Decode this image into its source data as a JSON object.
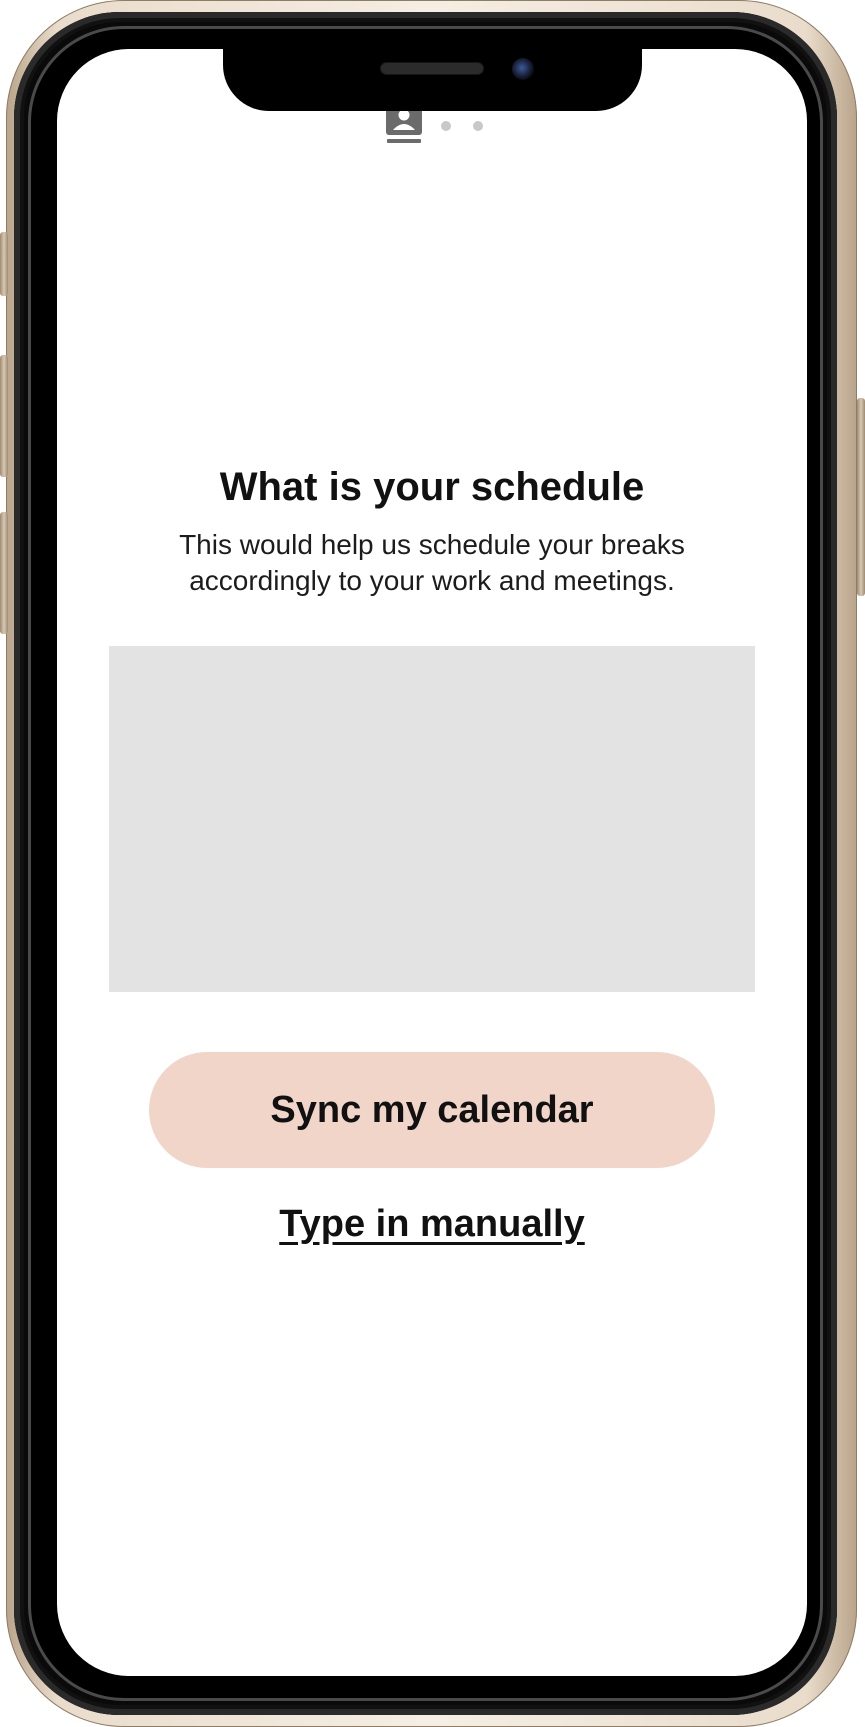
{
  "onboarding": {
    "progress": {
      "total_steps": 3,
      "current_step": 1,
      "current_icon": "contact-card-icon"
    },
    "title": "What is your schedule",
    "subtitle": "This would help us schedule your breaks accordingly to your work and meetings.",
    "sync_button_label": "Sync my calendar",
    "manual_link_label": "Type in manually"
  },
  "colors": {
    "sync_button_bg": "#f1d5c9",
    "placeholder_bg": "#e3e3e3",
    "inactive_dot": "#c8c8c8",
    "active_icon": "#6b6b6b"
  }
}
